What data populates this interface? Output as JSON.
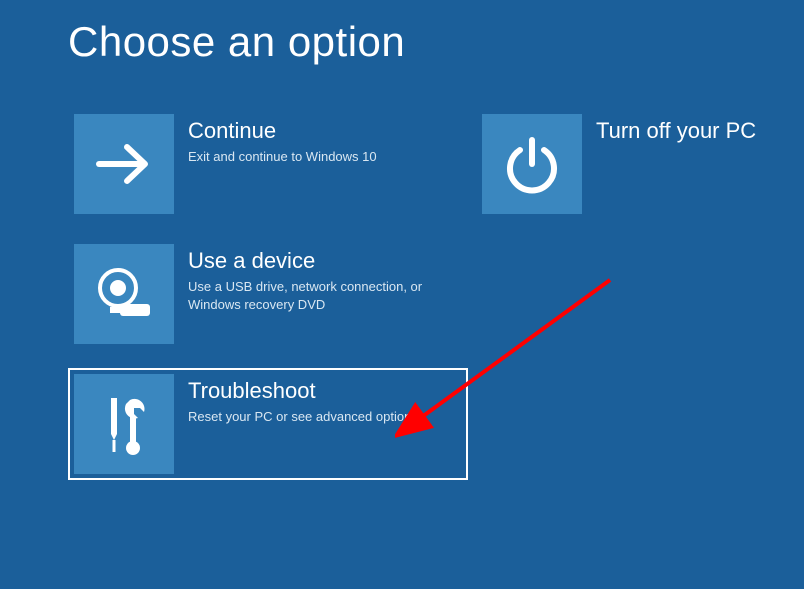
{
  "title": "Choose an option",
  "options": {
    "continue": {
      "title": "Continue",
      "desc": "Exit and continue to Windows 10"
    },
    "turnoff": {
      "title": "Turn off your PC",
      "desc": ""
    },
    "device": {
      "title": "Use a device",
      "desc": "Use a USB drive, network connection, or Windows recovery DVD"
    },
    "troubleshoot": {
      "title": "Troubleshoot",
      "desc": "Reset your PC or see advanced options"
    }
  }
}
